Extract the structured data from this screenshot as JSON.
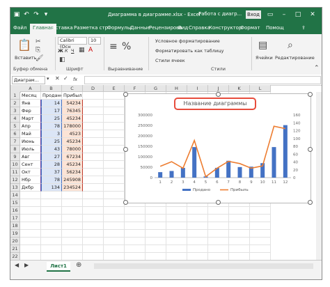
{
  "window": {
    "title": "Диаграмма в диаграмме.xlsx - Excel",
    "context_label": "Работа с диагр...",
    "enter_button": "Вход"
  },
  "tabs": [
    "Файл",
    "Главная",
    "Вставка",
    "Разметка стр",
    "Формулы",
    "Данные",
    "Рецензирова",
    "Вид",
    "Справка",
    "Конструктор",
    "Формат",
    "Помощ"
  ],
  "ribbon": {
    "paste_label": "Вставить",
    "font_name": "Calibri (Осн",
    "font_size": "10",
    "cond_format": "Условное форматирование",
    "format_table": "Форматировать как таблицу",
    "cell_styles": "Стили ячеек",
    "cells_label": "Ячейки",
    "editing_label": "Редактирование",
    "group_clipboard": "Буфер обмена",
    "group_font": "Шрифт",
    "group_align": "Выравнивание",
    "group_styles": "Стили"
  },
  "formula_bar": {
    "name_box": "Диаграм...",
    "fx": "fx"
  },
  "columns": [
    "A",
    "B",
    "C",
    "D",
    "E",
    "F",
    "G",
    "H",
    "I",
    "J",
    "K",
    "L"
  ],
  "rows": [
    "1",
    "2",
    "3",
    "4",
    "5",
    "6",
    "7",
    "8",
    "9",
    "10",
    "11",
    "12",
    "13",
    "14",
    "15",
    "16",
    "17",
    "18",
    "19",
    "20",
    "21",
    "22"
  ],
  "table": {
    "headers": [
      "Месяц",
      "Продано",
      "Прибыль"
    ],
    "rows": [
      [
        "Янв",
        "14",
        "54234"
      ],
      [
        "Фер",
        "17",
        "76345"
      ],
      [
        "Март",
        "25",
        "45234"
      ],
      [
        "Апр",
        "78",
        "178000"
      ],
      [
        "Май",
        "3",
        "4523"
      ],
      [
        "Июнь",
        "25",
        "45234"
      ],
      [
        "Июль",
        "43",
        "78000"
      ],
      [
        "Авг",
        "27",
        "67234"
      ],
      [
        "Сент",
        "28",
        "45234"
      ],
      [
        "Окт",
        "37",
        "56234"
      ],
      [
        "Нбр",
        "78",
        "245908"
      ],
      [
        "Дкбр",
        "134",
        "234524"
      ]
    ]
  },
  "chart_data": {
    "type": "bar",
    "title": "Название диаграммы",
    "categories": [
      "1",
      "2",
      "3",
      "4",
      "5",
      "6",
      "7",
      "8",
      "9",
      "10",
      "11",
      "12"
    ],
    "series": [
      {
        "name": "Продано",
        "kind": "bar",
        "axis": "right",
        "values": [
          14,
          17,
          25,
          78,
          3,
          25,
          43,
          27,
          28,
          37,
          78,
          134
        ],
        "color": "#4472c4"
      },
      {
        "name": "Прибыль",
        "kind": "line",
        "axis": "left",
        "values": [
          54234,
          76345,
          45234,
          178000,
          4523,
          45234,
          78000,
          67234,
          45234,
          56234,
          245908,
          234524
        ],
        "color": "#ed7d31"
      }
    ],
    "left_axis": {
      "ticks": [
        "0",
        "50000",
        "100000",
        "150000",
        "200000",
        "250000",
        "300000"
      ],
      "ylim": [
        0,
        300000
      ]
    },
    "right_axis": {
      "ticks": [
        "0",
        "20",
        "40",
        "60",
        "80",
        "100",
        "120",
        "140",
        "160"
      ],
      "ylim": [
        0,
        160
      ]
    },
    "legend": [
      "Продано",
      "Прибыль"
    ],
    "legend_position": "bottom",
    "grid": false
  },
  "status": {
    "sheet": "Лист1"
  }
}
